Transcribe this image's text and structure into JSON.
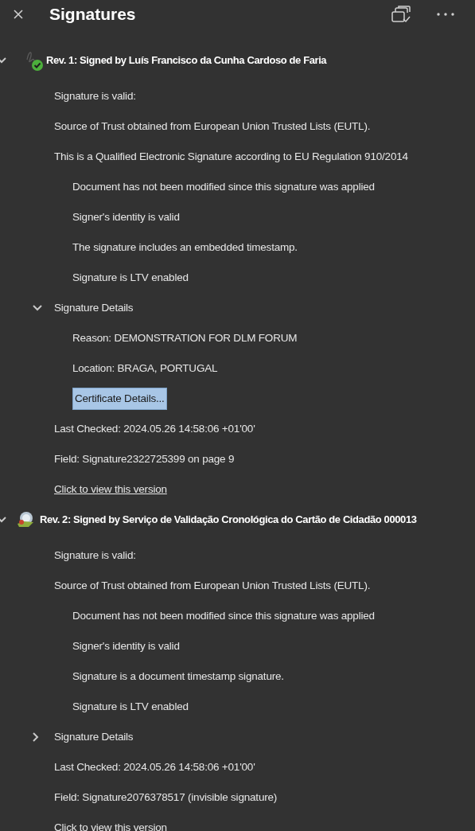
{
  "panel": {
    "title": "Signatures"
  },
  "signatures": [
    {
      "title": "Rev. 1: Signed by Luís Francisco da Cunha Cardoso de Faria",
      "kind": "signature",
      "expanded": true,
      "items": [
        {
          "kind": "text",
          "text": "Signature is valid:"
        },
        {
          "kind": "text",
          "text": "Source of Trust obtained from European Union Trusted Lists (EUTL)."
        },
        {
          "kind": "text",
          "text": "This is a Qualified Electronic Signature according to EU Regulation 910/2014",
          "children": [
            {
              "kind": "text",
              "text": "Document has not been modified since this signature was applied"
            },
            {
              "kind": "text",
              "text": "Signer's identity is valid"
            },
            {
              "kind": "text",
              "text": "The signature includes an embedded timestamp."
            },
            {
              "kind": "text",
              "text": "Signature is LTV enabled"
            }
          ]
        },
        {
          "kind": "group",
          "text": "Signature Details",
          "expanded": true,
          "children": [
            {
              "kind": "text",
              "text": "Reason: DEMONSTRATION FOR DLM FORUM"
            },
            {
              "kind": "text",
              "text": "Location: BRAGA, PORTUGAL"
            },
            {
              "kind": "button",
              "text": "Certificate Details...",
              "selected": true
            }
          ]
        },
        {
          "kind": "text",
          "text": "Last Checked: 2024.05.26 14:58:06 +01'00'"
        },
        {
          "kind": "text",
          "text": "Field: Signature2322725399 on page 9"
        },
        {
          "kind": "link",
          "text": "Click to view this version"
        }
      ]
    },
    {
      "title": "Rev. 2: Signed by Serviço de Validação Cronológica do Cartão de Cidadão 000013",
      "kind": "timestamp",
      "expanded": true,
      "items": [
        {
          "kind": "text",
          "text": "Signature is valid:"
        },
        {
          "kind": "text",
          "text": "Source of Trust obtained from European Union Trusted Lists (EUTL).",
          "children": [
            {
              "kind": "text",
              "text": "Document has not been modified since this signature was applied"
            },
            {
              "kind": "text",
              "text": "Signer's identity is valid"
            },
            {
              "kind": "text",
              "text": "Signature is a document timestamp signature."
            },
            {
              "kind": "text",
              "text": "Signature is LTV enabled"
            }
          ]
        },
        {
          "kind": "group",
          "text": "Signature Details",
          "expanded": false
        },
        {
          "kind": "text",
          "text": "Last Checked: 2024.05.26 14:58:06 +01'00'"
        },
        {
          "kind": "text",
          "text": "Field: Signature2076378517 (invisible signature)"
        },
        {
          "kind": "link",
          "text": "Click to view this version"
        }
      ]
    }
  ]
}
